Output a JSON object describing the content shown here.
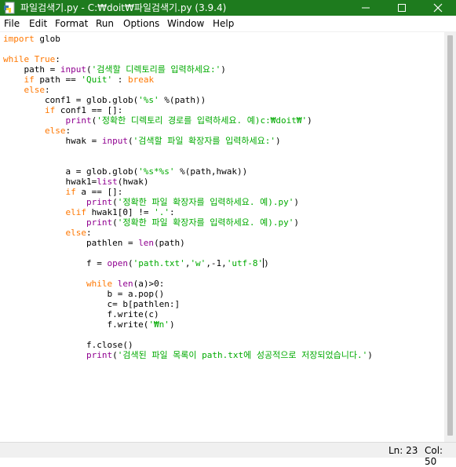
{
  "window": {
    "title": "파일검색기.py - C:₩doit₩파일검색기.py (3.9.4)",
    "title_bar_color": "#1e7b1e",
    "app_icon": "python-idle-icon"
  },
  "controls": {
    "minimize_icon": "minimize-icon",
    "maximize_icon": "maximize-icon",
    "close_icon": "close-icon"
  },
  "menu": [
    "File",
    "Edit",
    "Format",
    "Run",
    "Options",
    "Window",
    "Help"
  ],
  "syntax_colors": {
    "keyword": "#ff7700",
    "builtin": "#900090",
    "string": "#00aa00",
    "default": "#000000"
  },
  "code": [
    [
      [
        "kw",
        "import"
      ],
      [
        "p",
        " glob"
      ]
    ],
    [],
    [
      [
        "kw",
        "while"
      ],
      [
        "p",
        " "
      ],
      [
        "kw",
        "True"
      ],
      [
        "p",
        ":"
      ]
    ],
    [
      [
        "p",
        "    path = "
      ],
      [
        "bi",
        "input"
      ],
      [
        "p",
        "("
      ],
      [
        "str",
        "'검색할 디렉토리를 입력하세요:'"
      ],
      [
        "p",
        ")"
      ]
    ],
    [
      [
        "p",
        "    "
      ],
      [
        "kw",
        "if"
      ],
      [
        "p",
        " path == "
      ],
      [
        "str",
        "'Quit'"
      ],
      [
        "p",
        " : "
      ],
      [
        "kw",
        "break"
      ]
    ],
    [
      [
        "p",
        "    "
      ],
      [
        "kw",
        "else"
      ],
      [
        "p",
        ":"
      ]
    ],
    [
      [
        "p",
        "        conf1 = glob.glob("
      ],
      [
        "str",
        "'%s'"
      ],
      [
        "p",
        " %(path))"
      ]
    ],
    [
      [
        "p",
        "        "
      ],
      [
        "kw",
        "if"
      ],
      [
        "p",
        " conf1 == []:"
      ]
    ],
    [
      [
        "p",
        "            "
      ],
      [
        "bi",
        "print"
      ],
      [
        "p",
        "("
      ],
      [
        "str",
        "'정확한 디렉토리 경로를 입력하세요. 예)c:₩doit₩'"
      ],
      [
        "p",
        ")"
      ]
    ],
    [
      [
        "p",
        "        "
      ],
      [
        "kw",
        "else"
      ],
      [
        "p",
        ":"
      ]
    ],
    [
      [
        "p",
        "            hwak = "
      ],
      [
        "bi",
        "input"
      ],
      [
        "p",
        "("
      ],
      [
        "str",
        "'검색할 파일 확장자를 입력하세요:'"
      ],
      [
        "p",
        ")"
      ]
    ],
    [],
    [],
    [
      [
        "p",
        "            a = glob.glob("
      ],
      [
        "str",
        "'%s*%s'"
      ],
      [
        "p",
        " %(path,hwak))"
      ]
    ],
    [
      [
        "p",
        "            hwak1="
      ],
      [
        "bi",
        "list"
      ],
      [
        "p",
        "(hwak)"
      ]
    ],
    [
      [
        "p",
        "            "
      ],
      [
        "kw",
        "if"
      ],
      [
        "p",
        " a == []:"
      ]
    ],
    [
      [
        "p",
        "                "
      ],
      [
        "bi",
        "print"
      ],
      [
        "p",
        "("
      ],
      [
        "str",
        "'정확한 파일 확장자를 입력하세요. 예).py'"
      ],
      [
        "p",
        ")"
      ]
    ],
    [
      [
        "p",
        "            "
      ],
      [
        "kw",
        "elif"
      ],
      [
        "p",
        " hwak1[0] != "
      ],
      [
        "str",
        "'.'"
      ],
      [
        "p",
        ":"
      ]
    ],
    [
      [
        "p",
        "                "
      ],
      [
        "bi",
        "print"
      ],
      [
        "p",
        "("
      ],
      [
        "str",
        "'정확한 파일 확장자를 입력하세요. 예).py'"
      ],
      [
        "p",
        ")"
      ]
    ],
    [
      [
        "p",
        "            "
      ],
      [
        "kw",
        "else"
      ],
      [
        "p",
        ":"
      ]
    ],
    [
      [
        "p",
        "                pathlen = "
      ],
      [
        "bi",
        "len"
      ],
      [
        "p",
        "(path)"
      ]
    ],
    [],
    [
      [
        "p",
        "                f = "
      ],
      [
        "bi",
        "open"
      ],
      [
        "p",
        "("
      ],
      [
        "str",
        "'path.txt'"
      ],
      [
        "p",
        ","
      ],
      [
        "str",
        "'w'"
      ],
      [
        "p",
        ",-1,"
      ],
      [
        "str",
        "'utf-8'"
      ],
      [
        "caret",
        ""
      ],
      [
        "p",
        ")"
      ]
    ],
    [],
    [
      [
        "p",
        "                "
      ],
      [
        "kw",
        "while"
      ],
      [
        "p",
        " "
      ],
      [
        "bi",
        "len"
      ],
      [
        "p",
        "(a)>0:"
      ]
    ],
    [
      [
        "p",
        "                    b = a.pop()"
      ]
    ],
    [
      [
        "p",
        "                    c= b[pathlen:]"
      ]
    ],
    [
      [
        "p",
        "                    f.write(c)"
      ]
    ],
    [
      [
        "p",
        "                    f.write("
      ],
      [
        "str",
        "'₩n'"
      ],
      [
        "p",
        ")"
      ]
    ],
    [],
    [
      [
        "p",
        "                f.close()"
      ]
    ],
    [
      [
        "p",
        "                "
      ],
      [
        "bi",
        "print"
      ],
      [
        "p",
        "("
      ],
      [
        "str",
        "'검색된 파일 목록이 path.txt에 성공적으로 저장되었습니다.'"
      ],
      [
        "p",
        ")"
      ]
    ]
  ],
  "status": {
    "line": "Ln: 23",
    "col": "Col: 50"
  }
}
